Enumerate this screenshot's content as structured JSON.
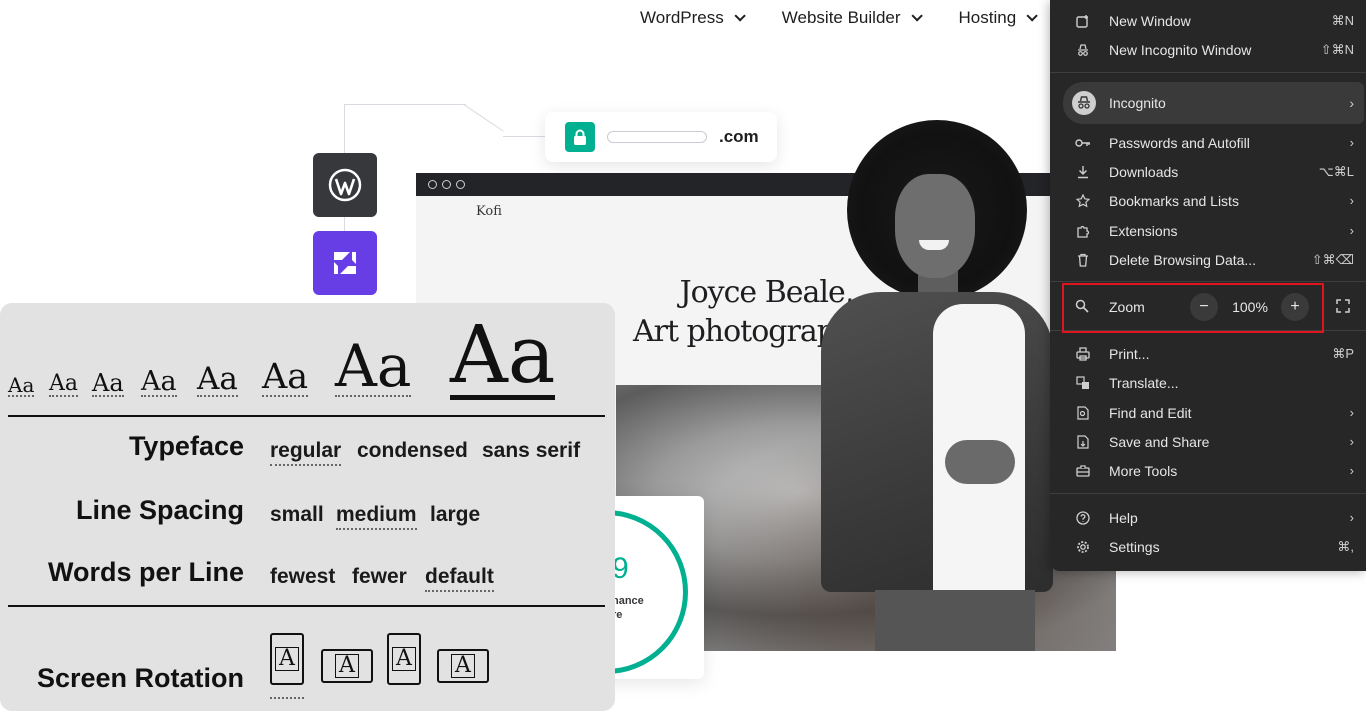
{
  "topnav": {
    "items": [
      {
        "label": "WordPress"
      },
      {
        "label": "Website Builder"
      },
      {
        "label": "Hosting"
      }
    ]
  },
  "illustration": {
    "domain_suffix": ".com",
    "site_brand": "Kofi",
    "headline_line1": "Joyce Beale,",
    "headline_line2": "Art photograph",
    "score_value": "9",
    "score_label_line1": "nance",
    "score_label_line2": "re",
    "colors": {
      "accent": "#00b090",
      "builder": "#673de6",
      "wp_tile": "#36383c"
    }
  },
  "reader_settings": {
    "font_sizes": [
      "Aa",
      "Aa",
      "Aa",
      "Aa",
      "Aa",
      "Aa",
      "Aa",
      "Aa"
    ],
    "selected_size_index": 7,
    "typeface": {
      "label": "Typeface",
      "options": [
        "regular",
        "condensed",
        "sans serif"
      ],
      "selected": "regular"
    },
    "line_spacing": {
      "label": "Line Spacing",
      "options": [
        "small",
        "medium",
        "large"
      ],
      "selected": "medium"
    },
    "words_per_line": {
      "label": "Words per Line",
      "options": [
        "fewest",
        "fewer",
        "default"
      ],
      "selected": "default"
    },
    "screen_rotation": {
      "label": "Screen Rotation",
      "glyph": "A"
    }
  },
  "chrome_menu": {
    "new_window": {
      "label": "New Window",
      "shortcut": "⌘N"
    },
    "new_incognito": {
      "label": "New Incognito Window",
      "shortcut": "⇧⌘N"
    },
    "profile": {
      "label": "Incognito",
      "arrow": "›"
    },
    "passwords": {
      "label": "Passwords and Autofill",
      "arrow": "›"
    },
    "downloads": {
      "label": "Downloads",
      "shortcut": "⌥⌘L"
    },
    "bookmarks": {
      "label": "Bookmarks and Lists",
      "arrow": "›"
    },
    "extensions": {
      "label": "Extensions",
      "arrow": "›"
    },
    "delete_data": {
      "label": "Delete Browsing Data...",
      "shortcut": "⇧⌘⌫"
    },
    "zoom": {
      "label": "Zoom",
      "minus": "−",
      "value": "100%",
      "plus": "+"
    },
    "print": {
      "label": "Print...",
      "shortcut": "⌘P"
    },
    "translate": {
      "label": "Translate..."
    },
    "find_edit": {
      "label": "Find and Edit",
      "arrow": "›"
    },
    "save_share": {
      "label": "Save and Share",
      "arrow": "›"
    },
    "more_tools": {
      "label": "More Tools",
      "arrow": "›"
    },
    "help": {
      "label": "Help",
      "arrow": "›"
    },
    "settings": {
      "label": "Settings",
      "shortcut": "⌘,"
    },
    "highlight_color": "#e0141e"
  }
}
